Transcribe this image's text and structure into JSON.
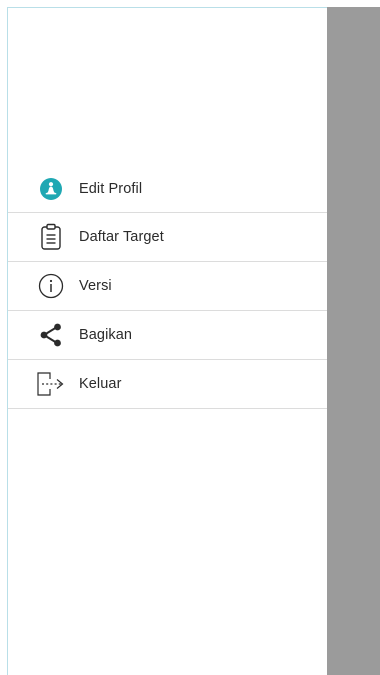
{
  "drawer": {
    "menu": [
      {
        "label": "Edit Profil",
        "icon": "profile-meditation-icon"
      },
      {
        "label": "Daftar Target",
        "icon": "clipboard-list-icon"
      },
      {
        "label": "Versi",
        "icon": "info-icon"
      },
      {
        "label": "Bagikan",
        "icon": "share-icon"
      },
      {
        "label": "Keluar",
        "icon": "logout-icon"
      }
    ]
  },
  "colors": {
    "accent": "#1fa8b3",
    "overlay": "#9b9b9b",
    "text": "#2b2b2b",
    "divider": "#dcdcdc"
  }
}
